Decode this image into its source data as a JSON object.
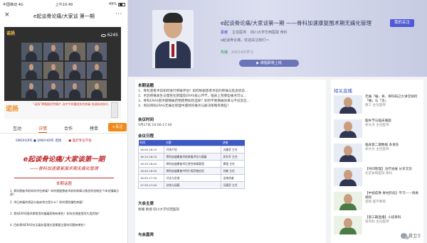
{
  "phone": {
    "status": {
      "carrier": "中国移动 4G",
      "time": "上午10:49",
      "battery": "49%"
    },
    "nav": {
      "close": "×",
      "title": "e起谈骨论痛/大家谈 第一期",
      "more": "···"
    },
    "video": {
      "brand": "诺扬",
      "viewers": "6245",
      "caption": "主持人: 王小 Masters 高冲 教授"
    },
    "ad": {
      "logo": "诺扬",
      "text": "“诺扬”牌氨酚羟考酮片 治疗中到重度急性疼痛 快速有效持久"
    },
    "tabs": [
      "互动",
      "详情",
      "合作",
      "榜单"
    ],
    "follow": "+关注",
    "poster": {
      "logo_left": "SINOHOPE ● SINOHOPE 诺扬",
      "logo_right": "● 医药专业学会",
      "title": "e起谈骨论痛/大家谈第一期",
      "subtitle": "——骨科加速康复围术期无痛化管理",
      "section": "本期话题",
      "questions": [
        "1. 骨科患者术前如何评估疼痛？如何根据患者术前的疼痛与焦虑状态制定个体化镇痛方案？",
        "2. 术后疼痛的原因与临床特点是什么？如何预防慢性疼痛？",
        "3. 骨科ERAS围术期常用的镇痛药物有哪些？如何合理使用阿片类药物？",
        "4. 目前骨科ERAS在无痛化管理方面需要注意的问题有哪些？"
      ]
    }
  },
  "desktop": {
    "hero": {
      "title": "e起谈骨论痛/大家谈第一期 ——骨科加速康复围术期无痛化管理",
      "follow_btn": "我的关注",
      "name": "蔡耀",
      "role": "主任医师",
      "hospital": "四川大学华西医院 骨科",
      "desc": "e起谈骨论痛，欢迎关注我们～",
      "status": "热播",
      "views": "24214次学习",
      "cta": "▶ 课程即将上线"
    },
    "content": {
      "topic_heading": "本期话题",
      "topics": [
        "1、骨科患者术前如何进行疼痛评估？如何根据患者术前的疼痛与焦虑状态...",
        "2、术后疼痛发生与慢性化管理及ERAS核心环节，临床上有哪些痛点可以...",
        "3、骨科ERAS围术期镇痛药物使用如何选择？如何平衡镇痛效果与不良反应...",
        "4、目前骨科ERAS无痛化管理中遇到的难点与解决策略有哪些？"
      ],
      "time_heading": "会议时间",
      "time": "5月17日  16:00-17:40",
      "schedule_heading": "会议日程",
      "schedule_headers": [
        "时间",
        "主题",
        "讲者"
      ],
      "schedule": [
        [
          "16:00-16:10",
          "开场介绍",
          "冯建武 主任"
        ],
        [
          "16:10-16:25",
          "骨科加速康复术前疼痛评估与镇痛",
          "邓东军 主任"
        ],
        [
          "16:25-16:40",
          "骨科加速康复术后急性疼痛管理",
          "黄强 主任"
        ],
        [
          "16:40-16:55",
          "骨科加速康复中阿片类药物应用",
          "孙敏 主任"
        ],
        [
          "16:55-17:35",
          "讨论与交流",
          "全体讲者"
        ],
        [
          "17:35-17:40",
          "总结与闭幕",
          "冯建武 主任"
        ]
      ],
      "host_heading": "大会主席",
      "host": "蔡耀 教授  四川大学华西医院",
      "more_heading": "与会嘉宾"
    },
    "sidebar": {
      "title": "相关直播",
      "items": [
        {
          "title": "无痛「痛」脊，骨科知己大讲堂如何「痛」与「治」",
          "sub": "唐三 主任医师"
        },
        {
          "title": "脑失节与临床难题",
          "sub": "徐文天 主任医师"
        },
        {
          "title": "临床第二期数据 多发伤",
          "sub": "徐文文 主任医师"
        },
        {
          "title": "【时间管理】治疗进展 分享交流",
          "sub": "北京协和医院 骨科"
        },
        {
          "title": "【中视成像 脊柱阶段】学习——骨质疏松",
          "sub": "诺扬 医学教育"
        },
        {
          "title": "【第三期直播】小班骨科",
          "sub": "肾内科 主任医师"
        }
      ]
    },
    "watermark": "骨卫士"
  }
}
